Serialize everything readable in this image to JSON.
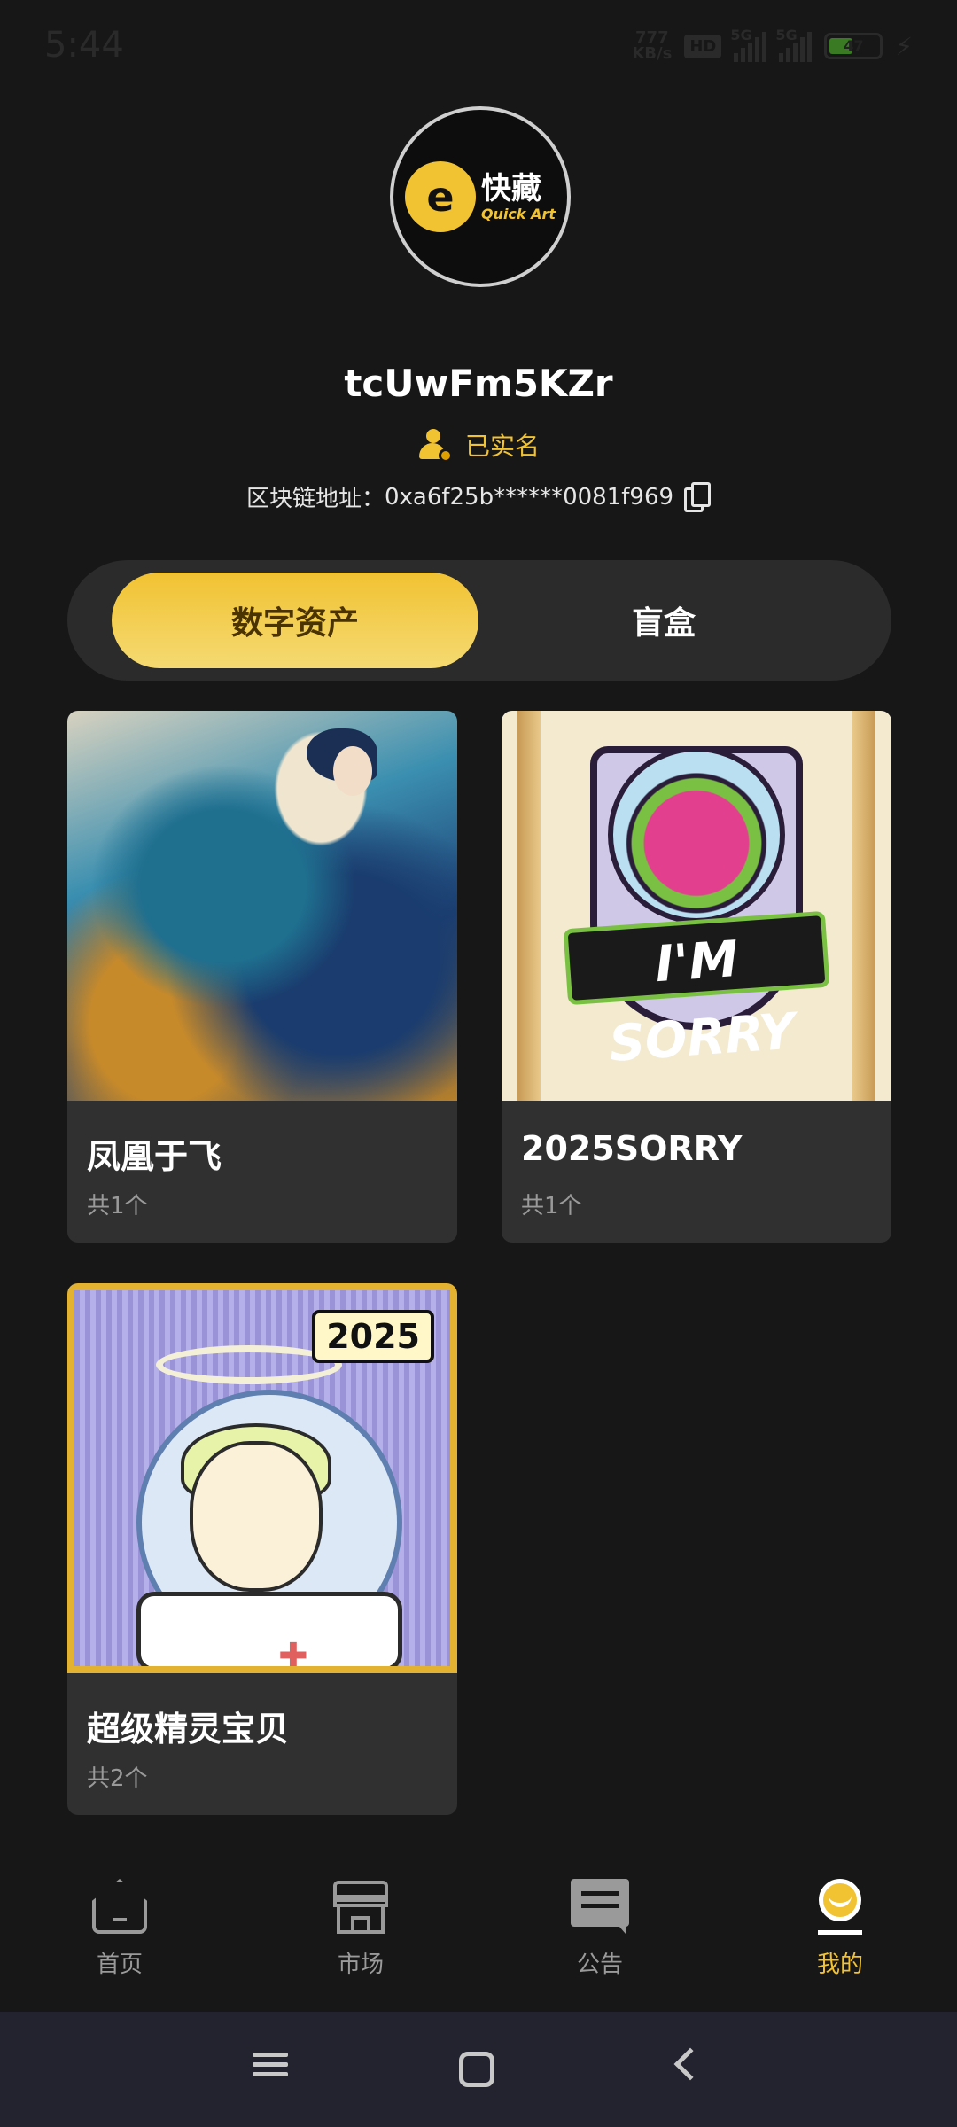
{
  "status_bar": {
    "time": "5:44",
    "net_speed_value": "777",
    "net_speed_unit": "KB/s",
    "hd": "HD",
    "network_1": "5G",
    "network_2": "5G",
    "battery": "47"
  },
  "profile": {
    "avatar_brand_cn": "快藏",
    "avatar_brand_en": "Quick Art",
    "username": "tcUwFm5KZr",
    "verified_label": "已实名",
    "address_label": "区块链地址：",
    "address_value": "0xa6f25b******0081f969"
  },
  "tabs": [
    {
      "label": "数字资产",
      "active": true
    },
    {
      "label": "盲盒",
      "active": false
    }
  ],
  "assets": [
    {
      "title": "凤凰于飞",
      "count": "共1个"
    },
    {
      "title": "2025SORRY",
      "count": "共1个",
      "image_text": "I'M SORRY"
    },
    {
      "title": "超级精灵宝贝",
      "count": "共2个",
      "image_badge": "2025"
    }
  ],
  "bottom_nav": [
    {
      "label": "首页",
      "icon": "home-icon",
      "active": false
    },
    {
      "label": "市场",
      "icon": "market-icon",
      "active": false
    },
    {
      "label": "公告",
      "icon": "notice-icon",
      "active": false
    },
    {
      "label": "我的",
      "icon": "mine-icon",
      "active": true
    }
  ],
  "colors": {
    "background": "#171717",
    "accent": "#f1c232",
    "card": "#303030",
    "muted_text": "#9a9a9a"
  }
}
